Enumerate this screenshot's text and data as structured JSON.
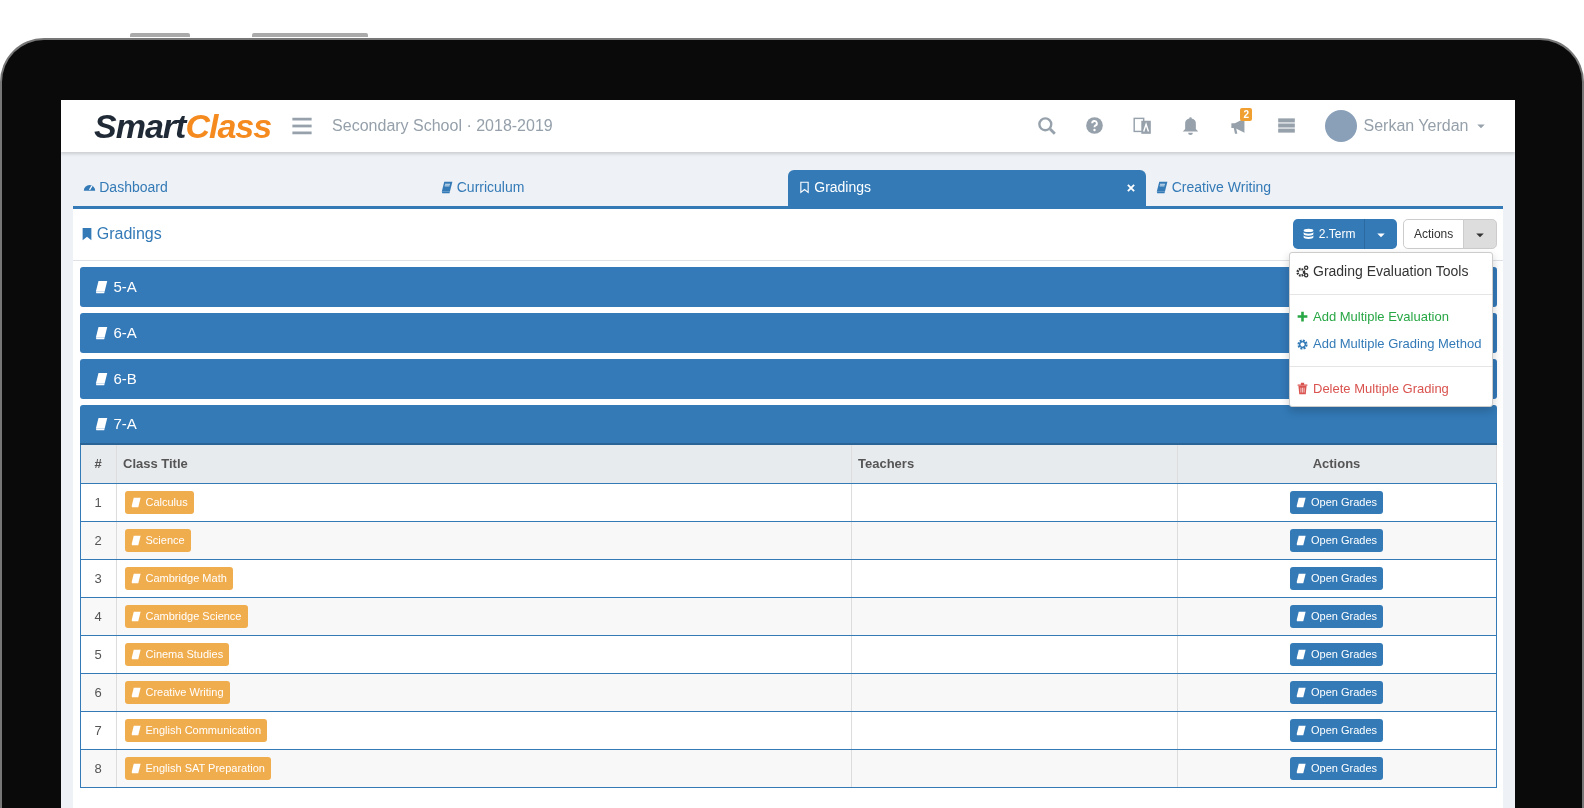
{
  "logo": {
    "dark": "Smart",
    "accent": "Class"
  },
  "header": {
    "school": "Secondary School · 2018-2019",
    "announcement_badge": "2",
    "user_name": "Serkan Yerdan"
  },
  "tabs": [
    {
      "label": "Dashboard",
      "kind": "dashboard",
      "selected": false,
      "closable": false
    },
    {
      "label": "Curriculum",
      "kind": "course",
      "selected": false,
      "closable": false
    },
    {
      "label": "Gradings",
      "kind": "grading",
      "selected": true,
      "closable": true
    },
    {
      "label": "Creative Writing",
      "kind": "course",
      "selected": false,
      "closable": false
    }
  ],
  "page_title": "Gradings",
  "term_button": "2.Term",
  "actions_button": "Actions",
  "actions_menu": [
    {
      "label": "Grading Evaluation Tools",
      "kind": "header"
    },
    {
      "label": "Add Multiple Evaluation",
      "kind": "add"
    },
    {
      "label": "Add Multiple Grading Method",
      "kind": "method"
    },
    {
      "label": "Delete Multiple Grading",
      "kind": "delete"
    }
  ],
  "groups": [
    {
      "title": "5-A",
      "expanded": false
    },
    {
      "title": "6-A",
      "expanded": false
    },
    {
      "title": "6-B",
      "expanded": false
    },
    {
      "title": "7-A",
      "expanded": true
    }
  ],
  "table": {
    "columns": [
      "#",
      "Class Title",
      "Teachers",
      "Actions"
    ],
    "rows": [
      {
        "number": "1",
        "class_title": "Calculus",
        "action": "Open Grades"
      },
      {
        "number": "2",
        "class_title": "Science",
        "action": "Open Grades"
      },
      {
        "number": "3",
        "class_title": "Cambridge Math",
        "action": "Open Grades"
      },
      {
        "number": "4",
        "class_title": "Cambridge Science",
        "action": "Open Grades"
      },
      {
        "number": "5",
        "class_title": "Cinema Studies",
        "action": "Open Grades"
      },
      {
        "number": "6",
        "class_title": "Creative Writing",
        "action": "Open Grades"
      },
      {
        "number": "7",
        "class_title": "English Communication",
        "action": "Open Grades"
      },
      {
        "number": "8",
        "class_title": "English SAT Preparation",
        "action": "Open Grades"
      }
    ]
  }
}
